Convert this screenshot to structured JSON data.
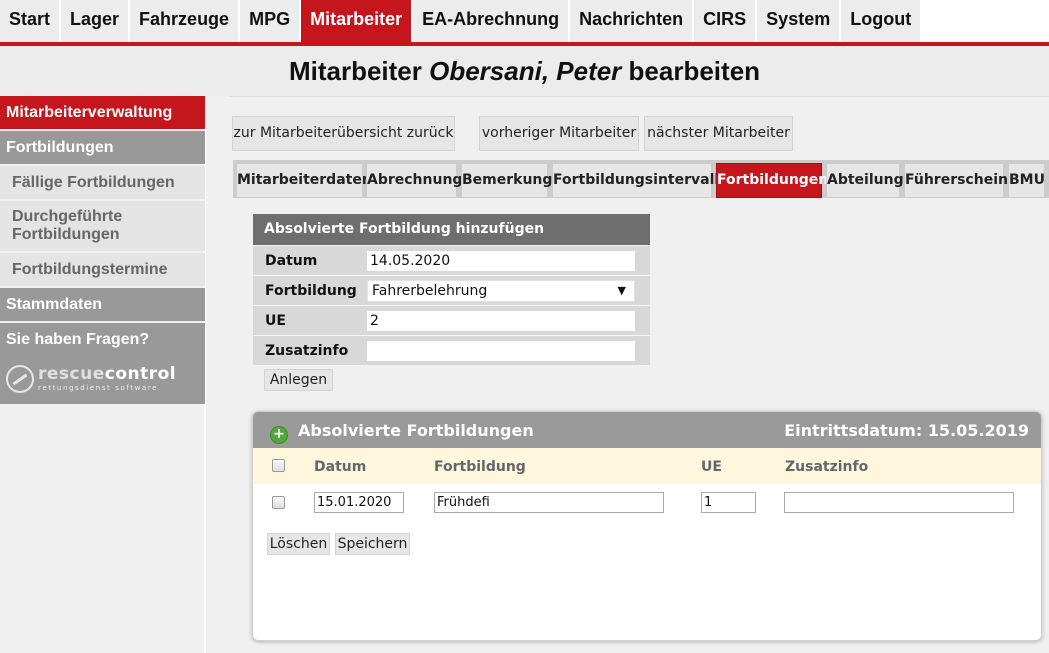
{
  "nav": {
    "items": [
      "Start",
      "Lager",
      "Fahrzeuge",
      "MPG",
      "Mitarbeiter",
      "EA-Abrechnung",
      "Nachrichten",
      "CIRS",
      "System",
      "Logout"
    ],
    "active": "Mitarbeiter"
  },
  "page": {
    "title_prefix": "Mitarbeiter",
    "title_name": "Obersani, Peter",
    "title_suffix": "bearbeiten"
  },
  "sidebar": {
    "mitarbeiterverwaltung": "Mitarbeiterverwaltung",
    "fortbildungen": "Fortbildungen",
    "faellige": "Fällige Fortbildungen",
    "durchgefuehrte": "Durchgeführte Fortbildungen",
    "termine": "Fortbildungstermine",
    "stammdaten": "Stammdaten",
    "fragen": "Sie haben Fragen?",
    "logo_a": "rescue",
    "logo_b": "control",
    "logo_sub": "rettungsdienst software"
  },
  "toolbar": {
    "back": "zur Mitarbeiterübersicht zurück",
    "prev": "vorheriger Mitarbeiter",
    "next": "nächster Mitarbeiter"
  },
  "tabs": [
    "Mitarbeiterdaten",
    "Abrechnung",
    "Bemerkung",
    "Fortbildungsintervalle",
    "Fortbildungen",
    "Abteilung",
    "Führerschein",
    "BMU"
  ],
  "add_form": {
    "heading": "Absolvierte Fortbildung hinzufügen",
    "datum_label": "Datum",
    "datum_value": "14.05.2020",
    "fortbildung_label": "Fortbildung",
    "fortbildung_value": "Fahrerbelehrung",
    "ue_label": "UE",
    "ue_value": "2",
    "zusatzinfo_label": "Zusatzinfo",
    "zusatzinfo_value": "",
    "submit": "Anlegen"
  },
  "list": {
    "heading": "Absolvierte Fortbildungen",
    "entry_date": "Eintrittsdatum: 15.05.2019",
    "columns": [
      "Datum",
      "Fortbildung",
      "UE",
      "Zusatzinfo"
    ],
    "rows": [
      {
        "datum": "15.01.2020",
        "fortbildung": "Frühdefi",
        "ue": "1",
        "zusatzinfo": ""
      }
    ],
    "delete": "Löschen",
    "save": "Speichern"
  },
  "colors": {
    "accent": "#c4161c",
    "sidebar_head": "#999999",
    "plus_icon": "#52a83e"
  }
}
